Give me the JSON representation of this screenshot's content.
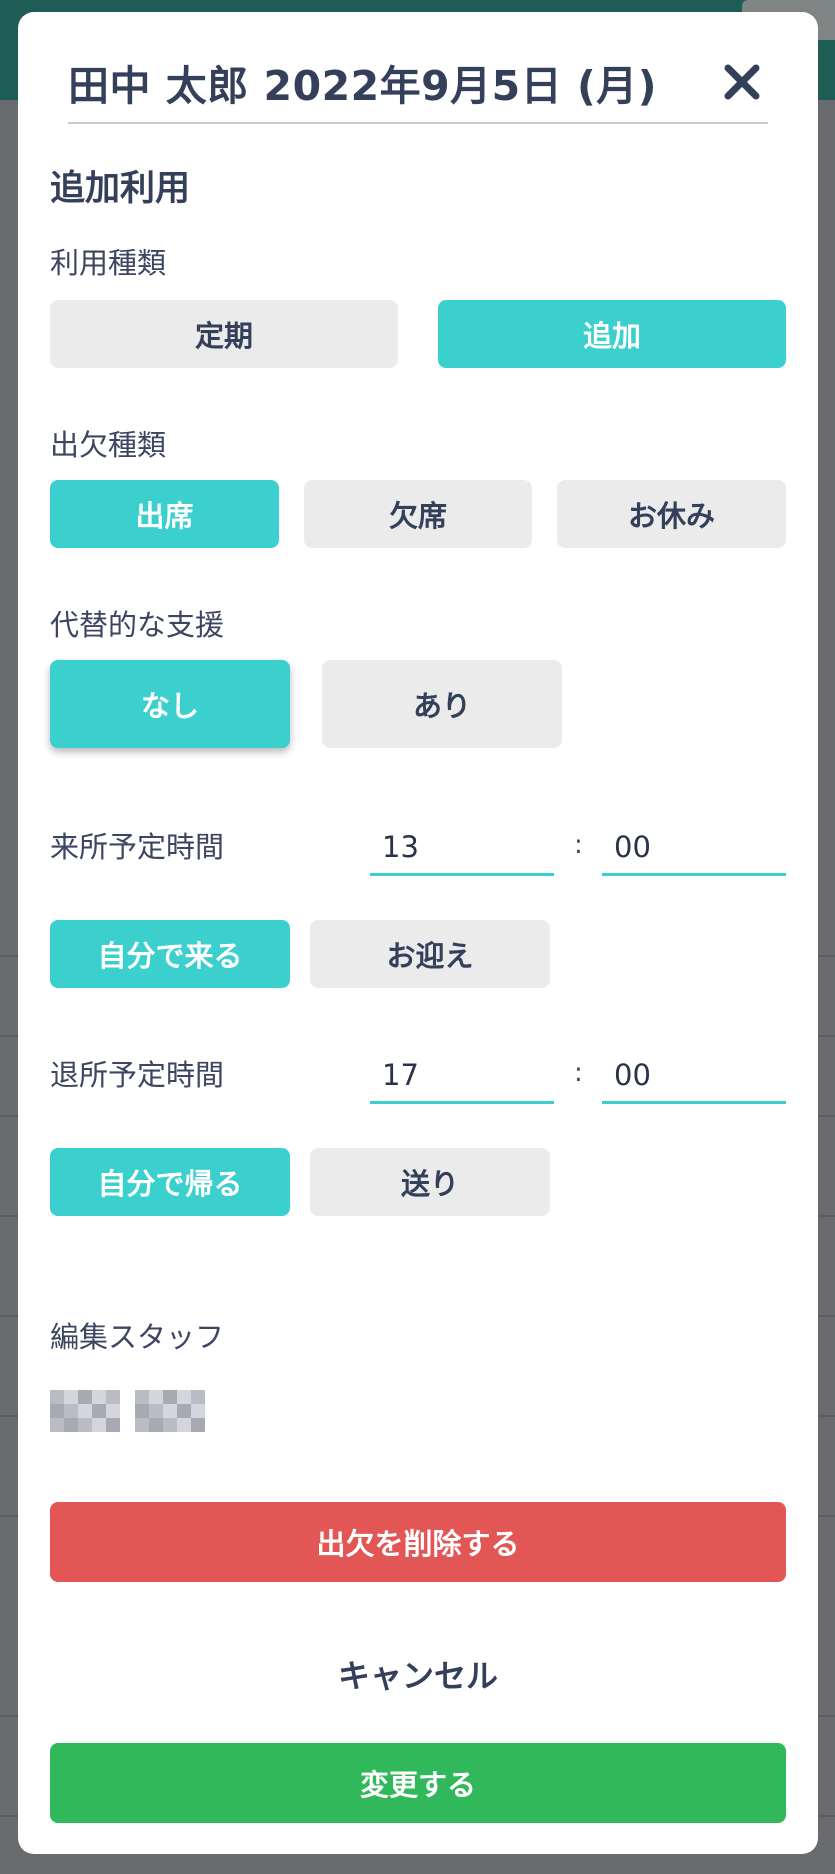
{
  "modal": {
    "title": "田中 太郎  2022年9月5日 (月)",
    "section_title": "追加利用",
    "usage_type": {
      "label": "利用種類",
      "options": [
        "定期",
        "追加"
      ],
      "selected": "追加"
    },
    "attendance_type": {
      "label": "出欠種類",
      "options": [
        "出席",
        "欠席",
        "お休み"
      ],
      "selected": "出席"
    },
    "alternative_support": {
      "label": "代替的な支援",
      "options": [
        "なし",
        "あり"
      ],
      "selected": "なし"
    },
    "arrival_time": {
      "label": "来所予定時間",
      "hour": "13",
      "minute": "00",
      "separator": ":",
      "options": [
        "自分で来る",
        "お迎え"
      ],
      "selected": "自分で来る"
    },
    "departure_time": {
      "label": "退所予定時間",
      "hour": "17",
      "minute": "00",
      "separator": ":",
      "options": [
        "自分で帰る",
        "送り"
      ],
      "selected": "自分で帰る"
    },
    "edit_staff": {
      "label": "編集スタッフ"
    },
    "delete_label": "出欠を削除する",
    "cancel_label": "キャンセル",
    "submit_label": "変更する"
  },
  "colors": {
    "accent": "#3bcfcd",
    "unselected": "#ebebec",
    "delete": "#e35656",
    "submit": "#30b85b",
    "text": "#34405a"
  },
  "icons": {
    "close": "close-icon"
  }
}
